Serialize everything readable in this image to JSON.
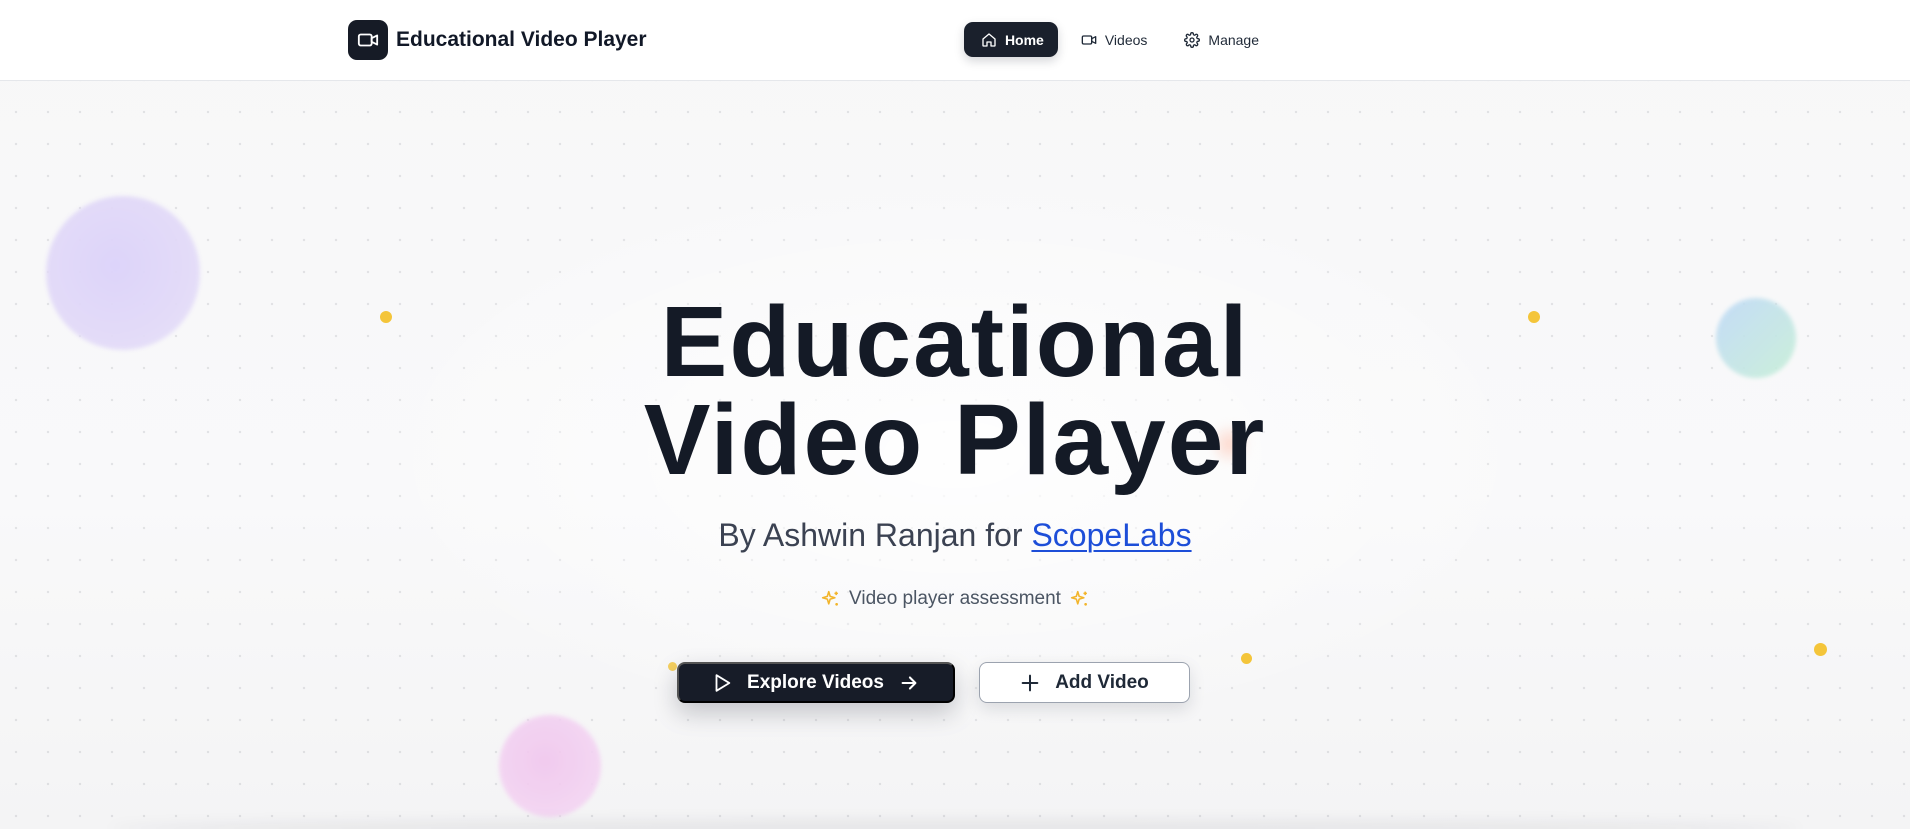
{
  "header": {
    "brand_title": "Educational Video Player",
    "brand_icon": "video-camera-icon",
    "nav": [
      {
        "label": "Home",
        "icon": "home-icon",
        "active": true
      },
      {
        "label": "Videos",
        "icon": "video-camera-icon",
        "active": false
      },
      {
        "label": "Manage",
        "icon": "gear-icon",
        "active": false
      }
    ]
  },
  "hero": {
    "title_line1": "Educational",
    "title_line2": "Video Player",
    "byline_prefix": "By Ashwin Ranjan for",
    "byline_link": "ScopeLabs",
    "tagline": "Video player assessment",
    "tagline_icon": "sparkles-icon",
    "primary_button": {
      "label": "Explore Videos",
      "icon_left": "play-icon",
      "icon_right": "arrow-right-icon"
    },
    "secondary_button": {
      "label": "Add Video",
      "icon_left": "plus-icon"
    }
  },
  "colors": {
    "primary": "#171c28",
    "link": "#1d4ed8",
    "accent_dot": "#f4c53a",
    "sparkle": "#f2b52c"
  }
}
